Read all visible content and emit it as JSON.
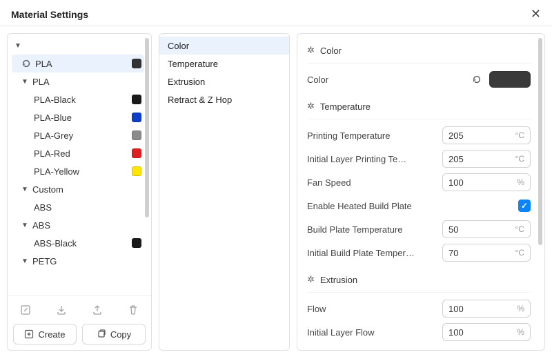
{
  "title": "Material Settings",
  "tree": {
    "root_caret": "▼",
    "pla_root": {
      "label": "PLA",
      "swatch": "#333333"
    },
    "pla_group": {
      "label": "PLA"
    },
    "pla_children": [
      {
        "label": "PLA-Black",
        "swatch": "#1a1a1a"
      },
      {
        "label": "PLA-Blue",
        "swatch": "#0b3ec9"
      },
      {
        "label": "PLA-Grey",
        "swatch": "#8b8b8b"
      },
      {
        "label": "PLA-Red",
        "swatch": "#e02020"
      },
      {
        "label": "PLA-Yellow",
        "swatch": "#ffe600"
      }
    ],
    "custom_group": {
      "label": "Custom"
    },
    "custom_children": [
      {
        "label": "ABS"
      }
    ],
    "abs_group": {
      "label": "ABS"
    },
    "abs_children": [
      {
        "label": "ABS-Black",
        "swatch": "#1a1a1a"
      }
    ],
    "petg_group": {
      "label": "PETG"
    }
  },
  "left_buttons": {
    "create": "Create",
    "copy": "Copy"
  },
  "middle": {
    "items": [
      {
        "label": "Color",
        "selected": true
      },
      {
        "label": "Temperature"
      },
      {
        "label": "Extrusion"
      },
      {
        "label": "Retract & Z Hop"
      }
    ]
  },
  "sections": {
    "color": {
      "title": "Color",
      "color_label": "Color",
      "color_value": "#3a3a3a"
    },
    "temperature": {
      "title": "Temperature",
      "rows": [
        {
          "label": "Printing Temperature",
          "value": "205",
          "unit": "°C"
        },
        {
          "label": "Initial Layer Printing Te…",
          "value": "205",
          "unit": "°C"
        },
        {
          "label": "Fan Speed",
          "value": "100",
          "unit": "%"
        }
      ],
      "heated_label": "Enable Heated Build Plate",
      "heated_checked": true,
      "rows2": [
        {
          "label": "Build Plate Temperature",
          "value": "50",
          "unit": "°C"
        },
        {
          "label": "Initial Build Plate Temper…",
          "value": "70",
          "unit": "°C"
        }
      ]
    },
    "extrusion": {
      "title": "Extrusion",
      "rows": [
        {
          "label": "Flow",
          "value": "100",
          "unit": "%"
        },
        {
          "label": "Initial Layer Flow",
          "value": "100",
          "unit": "%"
        }
      ]
    }
  }
}
